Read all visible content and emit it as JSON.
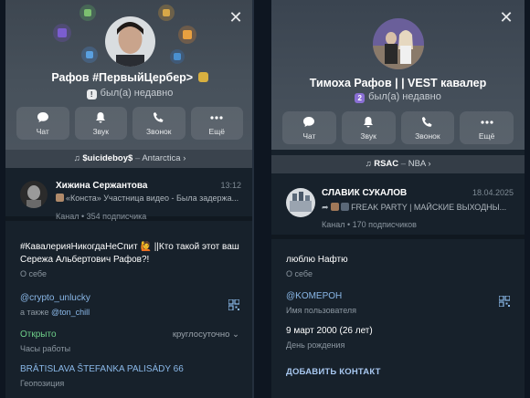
{
  "left": {
    "name": "Рафов #ПервыйЦербер>",
    "status": "был(а) недавно",
    "status_badge": "!",
    "actions": [
      {
        "label": "Чат",
        "icon": "chat-icon"
      },
      {
        "label": "Звук",
        "icon": "bell-icon"
      },
      {
        "label": "Звонок",
        "icon": "phone-icon"
      },
      {
        "label": "Ещё",
        "icon": "more-icon"
      }
    ],
    "music": {
      "artist": "$uicideboy$",
      "separator": "–",
      "track": "Antarctica",
      "chevron": "›"
    },
    "channel": {
      "title": "Хижина Сержантова",
      "date": "13:12",
      "preview": "«Конста» Участница видео - Была задержа...",
      "subscribers": "Канал • 354 подписчика"
    },
    "bio": {
      "text": "#КавалерияНикогдаНеСпит 🙋 ||Кто такой этот ваш Сережа Альбертович Рафов?!",
      "label": "О себе"
    },
    "username": {
      "value": "@crypto_unlucky",
      "also_prefix": "а также ",
      "also_value": "@ton_chill"
    },
    "hours": {
      "status": "Открыто",
      "value": "круглосуточно",
      "label": "Часы работы"
    },
    "location": {
      "value": "BRĀTISLAVA ŠTEFANKA PALISÁDY 66",
      "label": "Геопозиция"
    }
  },
  "right": {
    "name": "Тимоха Рафов | | VEST кавалер",
    "status": "был(а) недавно",
    "status_badge": "2",
    "actions": [
      {
        "label": "Чат",
        "icon": "chat-icon"
      },
      {
        "label": "Звук",
        "icon": "bell-icon"
      },
      {
        "label": "Звонок",
        "icon": "phone-icon"
      },
      {
        "label": "Ещё",
        "icon": "more-icon"
      }
    ],
    "music": {
      "artist": "RSAC",
      "separator": "–",
      "track": "NBA",
      "chevron": "›"
    },
    "channel": {
      "title": "СЛАВИК СУКАЛОВ",
      "date": "18.04.2025",
      "preview": "FREAK PARTY | МАЙСКИЕ ВЫХОДНЫ...",
      "subscribers": "Канал • 170 подписчиков"
    },
    "bio": {
      "text": "люблю Нафтю",
      "label": "О себе"
    },
    "username": {
      "value": "@KOMEPOH",
      "label": "Имя пользователя"
    },
    "birthday": {
      "value": "9 март 2000 (26 лет)",
      "label": "День рождения"
    },
    "add_contact": "ДОБАВИТЬ КОНТАКТ"
  },
  "close_glyph": "✕",
  "colors": {
    "accent_link": "#8ab8e8",
    "open_green": "#6fd08a",
    "panel_bg": "#17212b",
    "badge_purple": "#8a6fd4"
  }
}
